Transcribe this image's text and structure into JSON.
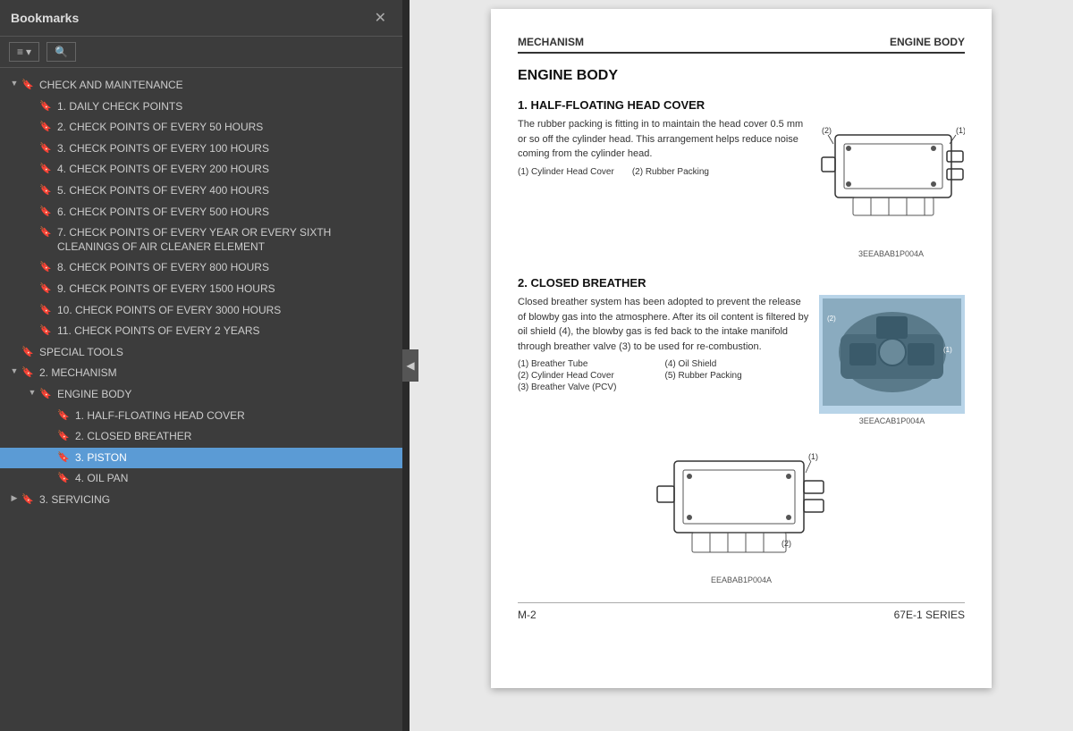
{
  "sidebar": {
    "title": "Bookmarks",
    "close_label": "✕",
    "toolbar": {
      "list_btn": "≡ ▾",
      "find_btn": "🔍"
    },
    "items": [
      {
        "id": "check-maintenance",
        "level": 0,
        "toggle": "down",
        "has_icon": true,
        "label": "CHECK AND MAINTENANCE",
        "selected": false
      },
      {
        "id": "daily-check",
        "level": 1,
        "toggle": "none",
        "has_icon": true,
        "label": "1. DAILY CHECK POINTS",
        "selected": false
      },
      {
        "id": "50-hours",
        "level": 1,
        "toggle": "none",
        "has_icon": true,
        "label": "2. CHECK POINTS OF EVERY 50 HOURS",
        "selected": false
      },
      {
        "id": "100-hours",
        "level": 1,
        "toggle": "none",
        "has_icon": true,
        "label": "3. CHECK POINTS OF EVERY 100 HOURS",
        "selected": false
      },
      {
        "id": "200-hours",
        "level": 1,
        "toggle": "none",
        "has_icon": true,
        "label": "4. CHECK POINTS OF EVERY 200 HOURS",
        "selected": false
      },
      {
        "id": "400-hours",
        "level": 1,
        "toggle": "none",
        "has_icon": true,
        "label": "5. CHECK POINTS OF EVERY 400 HOURS",
        "selected": false
      },
      {
        "id": "500-hours",
        "level": 1,
        "toggle": "none",
        "has_icon": true,
        "label": "6. CHECK POINTS OF EVERY 500 HOURS",
        "selected": false
      },
      {
        "id": "year-or-six",
        "level": 1,
        "toggle": "none",
        "has_icon": true,
        "label": "7. CHECK POINTS OF EVERY YEAR OR EVERY SIXTH CLEANINGS OF AIR CLEANER ELEMENT",
        "selected": false
      },
      {
        "id": "800-hours",
        "level": 1,
        "toggle": "none",
        "has_icon": true,
        "label": "8. CHECK POINTS OF EVERY 800 HOURS",
        "selected": false
      },
      {
        "id": "1500-hours",
        "level": 1,
        "toggle": "none",
        "has_icon": true,
        "label": "9. CHECK POINTS OF EVERY 1500 HOURS",
        "selected": false
      },
      {
        "id": "3000-hours",
        "level": 1,
        "toggle": "none",
        "has_icon": true,
        "label": "10. CHECK POINTS OF EVERY 3000 HOURS",
        "selected": false
      },
      {
        "id": "2-years",
        "level": 1,
        "toggle": "none",
        "has_icon": true,
        "label": "11. CHECK POINTS OF EVERY 2 YEARS",
        "selected": false
      },
      {
        "id": "special-tools",
        "level": 0,
        "toggle": "none",
        "has_icon": true,
        "label": "SPECIAL TOOLS",
        "selected": false
      },
      {
        "id": "mechanism",
        "level": 0,
        "toggle": "down",
        "has_icon": true,
        "label": "2. MECHANISM",
        "selected": false
      },
      {
        "id": "engine-body",
        "level": 1,
        "toggle": "down",
        "has_icon": true,
        "label": "ENGINE BODY",
        "selected": false
      },
      {
        "id": "half-floating",
        "level": 2,
        "toggle": "none",
        "has_icon": true,
        "label": "1. HALF-FLOATING HEAD COVER",
        "selected": false
      },
      {
        "id": "closed-breather",
        "level": 2,
        "toggle": "none",
        "has_icon": true,
        "label": "2. CLOSED BREATHER",
        "selected": false
      },
      {
        "id": "piston",
        "level": 2,
        "toggle": "none",
        "has_icon": true,
        "label": "3. PISTON",
        "selected": true
      },
      {
        "id": "oil-pan",
        "level": 2,
        "toggle": "none",
        "has_icon": true,
        "label": "4. OIL PAN",
        "selected": false
      },
      {
        "id": "servicing",
        "level": 0,
        "toggle": "right",
        "has_icon": true,
        "label": "3. SERVICING",
        "selected": false
      }
    ]
  },
  "main": {
    "header_left": "MECHANISM",
    "header_right": "ENGINE BODY",
    "section_title": "ENGINE BODY",
    "section1": {
      "title": "1.  HALF-FLOATING HEAD COVER",
      "text": "The rubber packing is fitting in to maintain the head cover 0.5 mm or so off the cylinder head.  This arrangement helps reduce noise coming from the cylinder head.",
      "caption1": "(1) Cylinder Head Cover",
      "caption2": "(2) Rubber Packing",
      "diagram_label": "3EEABAB1P004A"
    },
    "section2": {
      "title": "2.  CLOSED BREATHER",
      "text": "Closed breather system has been adopted to prevent the release of blowby gas into the atmosphere. After its oil content is filtered by oil shield (4), the blowby gas is fed back to the intake manifold through breather valve (3) to be used for re-combustion.",
      "captions": [
        "(1) Breather Tube",
        "(4) Oil Shield",
        "(2) Cylinder Head Cover",
        "(5) Rubber Packing",
        "(3) Breather Valve (PCV)"
      ],
      "diagram_label": "3EEACAB1P004A"
    },
    "section3": {
      "diagram_label": "EEABAB1P004A"
    },
    "footer_left": "M-2",
    "footer_right": "67E-1 SERIES"
  }
}
